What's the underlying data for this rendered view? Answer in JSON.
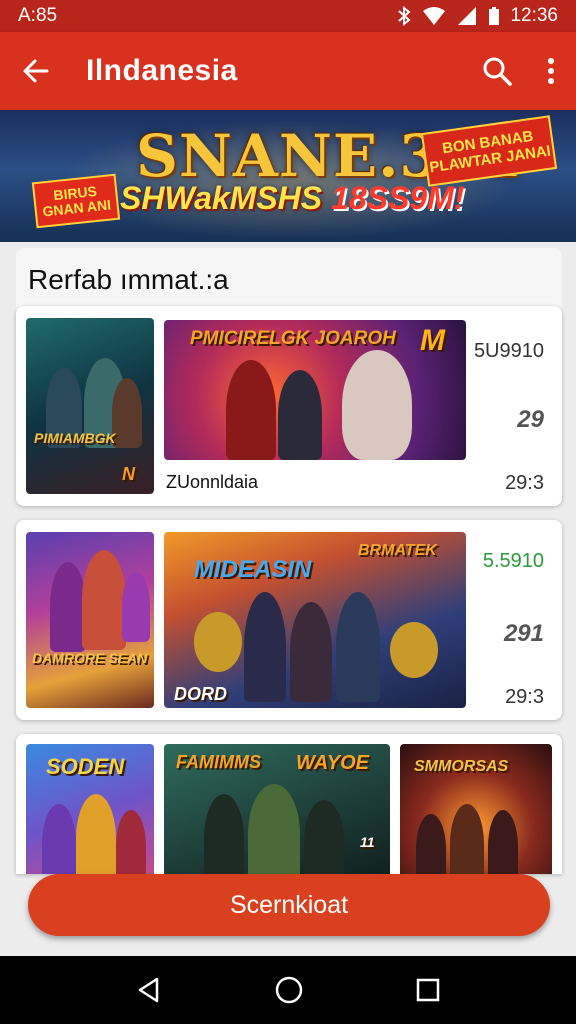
{
  "status_bar": {
    "time_left": "A:85",
    "time_right": "12:36"
  },
  "app_bar": {
    "title": "Ilndanesia"
  },
  "banner": {
    "title": "SNANE.311",
    "subtitle_main": "SHWakMSHS",
    "subtitle_red": "18SS9M!",
    "tag_left": "BIRUS GNAN ANI",
    "tag_right": "BON BANAB PLAWTAR JANAI"
  },
  "section": {
    "heading": "Rerfab ımmat.:a"
  },
  "cards": [
    {
      "poster_label": "PIMIAMBGK",
      "wide_label": "PMICIRELGK JOAROH",
      "wide_badge": "M",
      "caption": "ZUonnldaia",
      "meta_top": "5U9910",
      "meta_mid": "29",
      "meta_bottom": "29:3"
    },
    {
      "poster_label": "DAMRORE SEAN",
      "wide_label": "MIDEASIN",
      "wide_label_2": "BRMATEK",
      "wide_sub": "DORD",
      "meta_top": "5.5910",
      "meta_mid": "291",
      "meta_bottom": "29:3"
    },
    {
      "a1_label": "SODEN",
      "a2_label": "FAMIMMS",
      "a2_label_2": "WAYOE",
      "a2_sub": "11",
      "a3_label": "SMMORSAS"
    }
  ],
  "cta": {
    "label": "Scernkioat"
  },
  "colors": {
    "primary": "#d8321f",
    "status_bar": "#b8251a",
    "button": "#d8401f",
    "price_green": "#2a9a3a"
  },
  "icons": [
    "back-arrow-icon",
    "search-icon",
    "more-vert-icon",
    "nav-back-icon",
    "nav-home-icon",
    "nav-recents-icon"
  ]
}
